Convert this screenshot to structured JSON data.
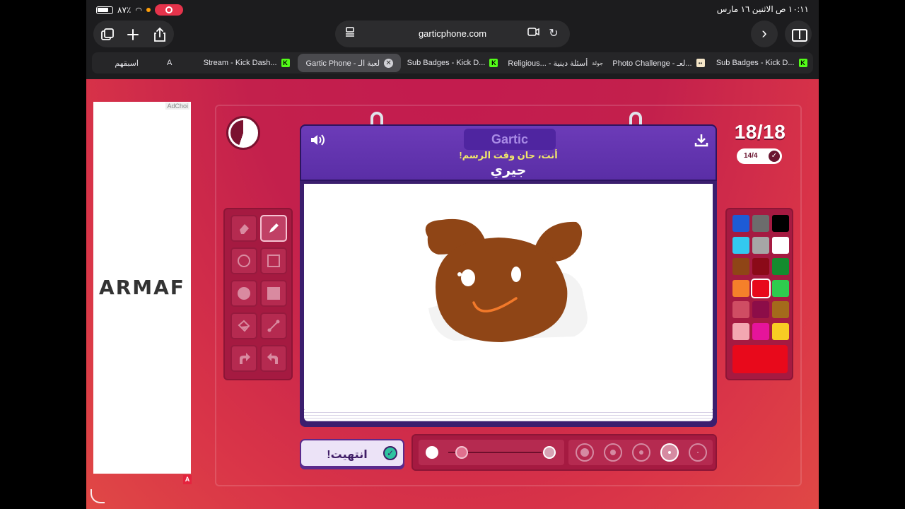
{
  "status": {
    "battery": "٨٧٪",
    "datetime": "١٠:١١ ص   الاثنين ١٦ مارس"
  },
  "browser": {
    "url": "garticphone.com",
    "tabs": [
      {
        "label": "اسبقهم",
        "badge": "A"
      },
      {
        "label": "Stream - Kick Dash...",
        "badge": "K"
      },
      {
        "label": "Gartic Phone - لعبة الـ",
        "badge": "close"
      },
      {
        "label": "Sub Badges - Kick D...",
        "badge": "K"
      },
      {
        "label": "Religious... - أسئلة دينية",
        "badge": "جولة"
      },
      {
        "label": "Photo Challenge - لعـ...",
        "badge": "img"
      },
      {
        "label": "Sub Badges - Kick D...",
        "badge": "K"
      }
    ]
  },
  "ad": {
    "adchoices": "AdChoi",
    "brand": "ARMAF",
    "badge": "A"
  },
  "game": {
    "logo": "Gartic",
    "message": "أنت، حان وقت الرسم!",
    "word": "جيري",
    "round": "18/18",
    "round_sub": "14/4",
    "done_label": "انتهيت!",
    "current_color": "#e8091b",
    "opacity": 0.15,
    "palette": [
      "#1d5bd6",
      "#6c6c6c",
      "#000000",
      "#33c9f0",
      "#a6a6a6",
      "#ffffff",
      "#8f4516",
      "#8b0a18",
      "#148b2e",
      "#f5802a",
      "#e8091b",
      "#2ecc4e",
      "#cf4d63",
      "#8c0d48",
      "#a46a1b",
      "#f3a7b1",
      "#e6149b",
      "#f8cc23"
    ],
    "tools": [
      "eraser-icon",
      "pencil-icon",
      "circle-outline-icon",
      "square-outline-icon",
      "circle-fill-icon",
      "square-fill-icon",
      "bucket-icon",
      "line-icon",
      "undo-icon",
      "redo-icon"
    ],
    "selected_tool": "pencil-icon",
    "brush_sizes": 5,
    "selected_size": 4
  }
}
